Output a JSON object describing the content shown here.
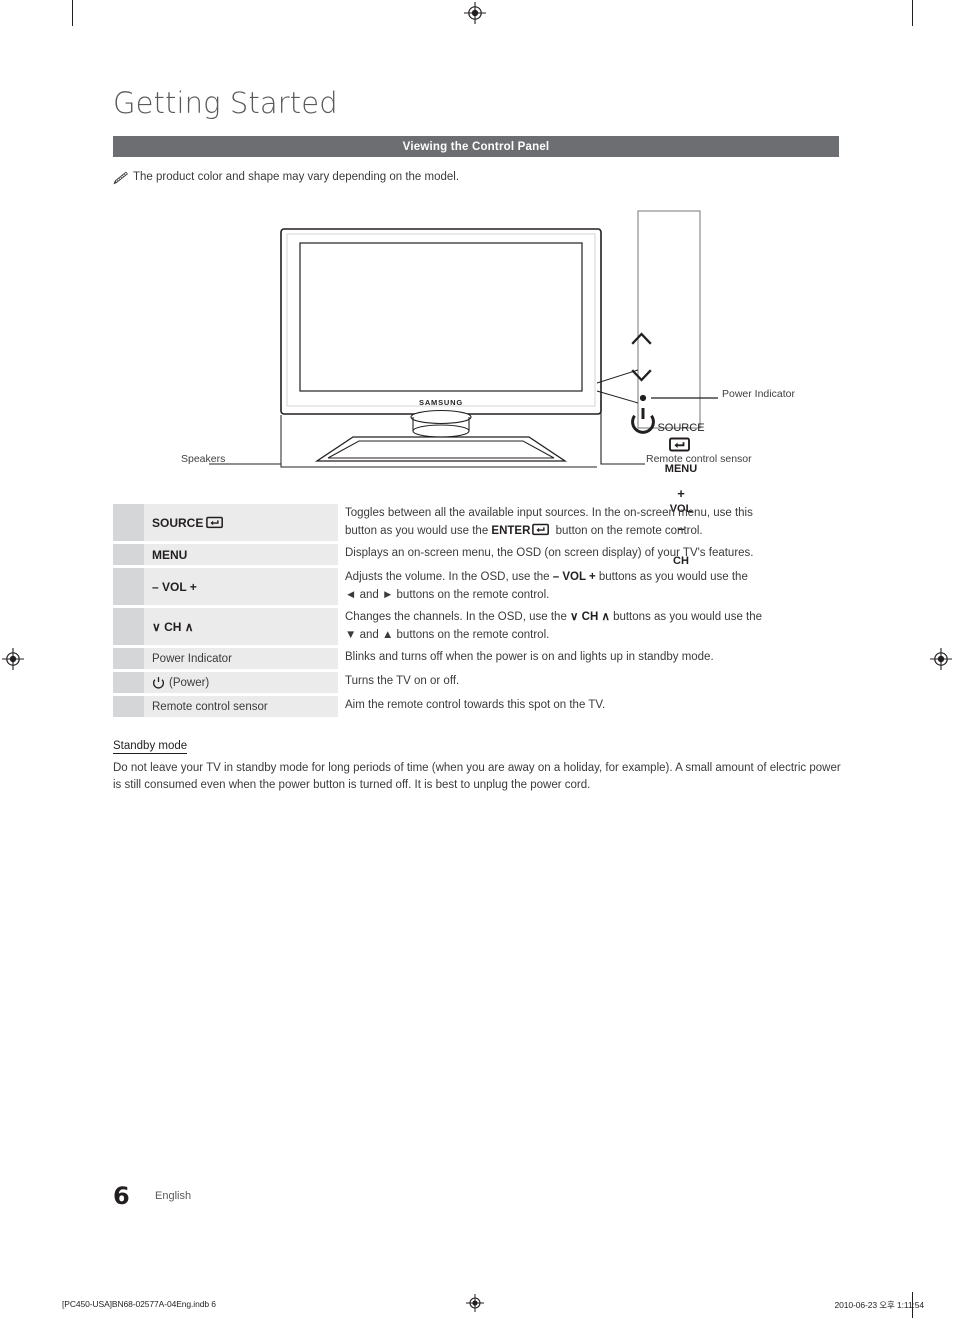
{
  "document": {
    "chapter_title": "Getting Started",
    "section_title": "Viewing the Control Panel",
    "note": "The product color and shape may vary depending on the model.",
    "note_icon": "pencil-icon"
  },
  "diagram": {
    "brand_logo": "SAMSUNG",
    "callouts": {
      "speakers": "Speakers",
      "power_indicator": "Power Indicator",
      "remote_control_sensor": "Remote control sensor"
    },
    "control_panel": {
      "source_label": "SOURCE",
      "source_icon": "enter-source-icon",
      "menu_label": "MENU",
      "vol_plus": "+",
      "vol_label": "VOL",
      "vol_minus": "–",
      "ch_up_icon": "chevron-up-icon",
      "ch_label": "CH",
      "ch_down_icon": "chevron-down-icon",
      "power_indicator_icon": "power-indicator-dot-icon",
      "power_icon": "power-symbol-icon"
    }
  },
  "spec_table": {
    "rows": [
      {
        "key_label": "SOURCE",
        "key_icon": "enter-source-icon",
        "key_style": "strong",
        "desc_line1": "Toggles between all the available input sources. In the on-screen menu, use this",
        "desc_line2_a": "button as you would use the ",
        "desc_line2_enter": "ENTER",
        "desc_line2_b": " button on the remote control.",
        "height": "tall"
      },
      {
        "key_label": "MENU",
        "key_style": "strong",
        "desc_line1": "Displays an on-screen menu, the OSD (on screen display) of your TV's features.",
        "height": "short"
      },
      {
        "key_label": "– VOL +",
        "key_style": "strong",
        "desc_line1_a": "Adjusts the volume. In the OSD, use the ",
        "desc_line1_inline": "– VOL +",
        "desc_line1_b": " buttons as you would use the",
        "desc_line2": "◄ and ► buttons on the remote control.",
        "height": "tall"
      },
      {
        "key_label": "∨ CH ∧",
        "key_style": "strong",
        "desc_line1_a": "Changes the channels. In the OSD, use the ",
        "desc_line1_inline": "∨ CH ∧",
        "desc_line1_b": " buttons as you would use the",
        "desc_line2": "▼ and ▲ buttons on the remote control.",
        "height": "tall"
      },
      {
        "key_label": "Power Indicator",
        "key_style": "plain",
        "desc_line1": "Blinks and turns off when the power is on and lights up in standby mode.",
        "height": "short"
      },
      {
        "key_label": "(Power)",
        "key_icon": "power-symbol-icon",
        "key_style": "plain",
        "desc_line1": "Turns the TV on or off.",
        "height": "short"
      },
      {
        "key_label": "Remote control sensor",
        "key_style": "plain",
        "desc_line1": "Aim the remote control towards this spot on the TV.",
        "height": "short"
      }
    ]
  },
  "standby": {
    "heading": "Standby mode",
    "body_line1": "Do not leave your TV in standby mode for long periods of time (when you are away on a holiday, for example). A small amount",
    "body_line2": "of electric power is still consumed even when the power button is turned off. It is best to unplug the power cord."
  },
  "footer": {
    "page_number": "6",
    "language": "English",
    "print_file": "[PC450-USA]BN68-02577A-04Eng.indb   6",
    "print_timestamp": "2010-06-23   오후 1:11:54",
    "registration_mark_icon": "registration-target-icon"
  },
  "colors": {
    "section_bar": "#6d6e71",
    "swatch": "#d5d6d8",
    "key_band": "#ebebec",
    "text": "#3b3b3d",
    "title": "#58595b"
  }
}
